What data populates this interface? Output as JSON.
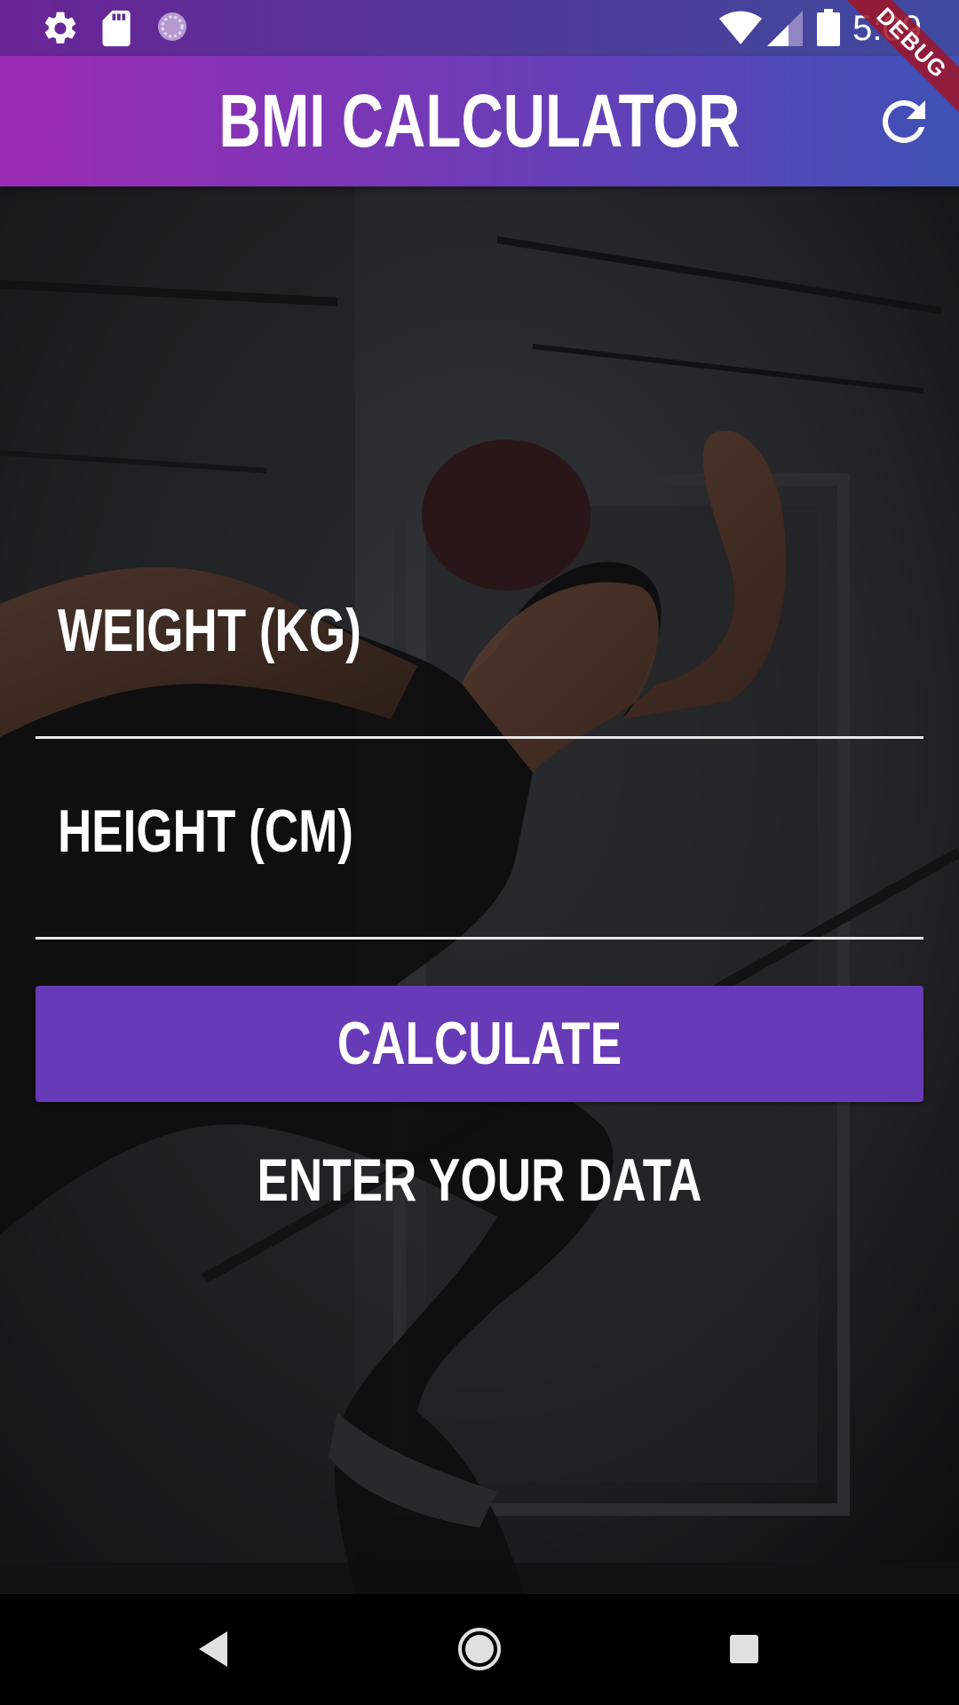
{
  "status_bar": {
    "time": "5:09",
    "icons": [
      "settings-icon",
      "sd-card-icon",
      "loading-icon",
      "wifi-icon",
      "cell-signal-icon",
      "battery-icon"
    ]
  },
  "app_bar": {
    "title": "BMI CALCULATOR",
    "action_icon": "refresh-icon"
  },
  "debug_banner": "DEBUG",
  "form": {
    "weight_label": "WEIGHT  (KG)",
    "height_label": "HEIGHT  (CM)",
    "calculate_label": "CALCULATE",
    "result_text": "ENTER YOUR DATA"
  },
  "nav_bar": {
    "icons": [
      "back-icon",
      "home-icon",
      "recents-icon"
    ]
  },
  "colors": {
    "app_bar_start": "#9c2bb3",
    "app_bar_end": "#3f51b5",
    "button": "#673ab7",
    "text": "#ffffff"
  }
}
